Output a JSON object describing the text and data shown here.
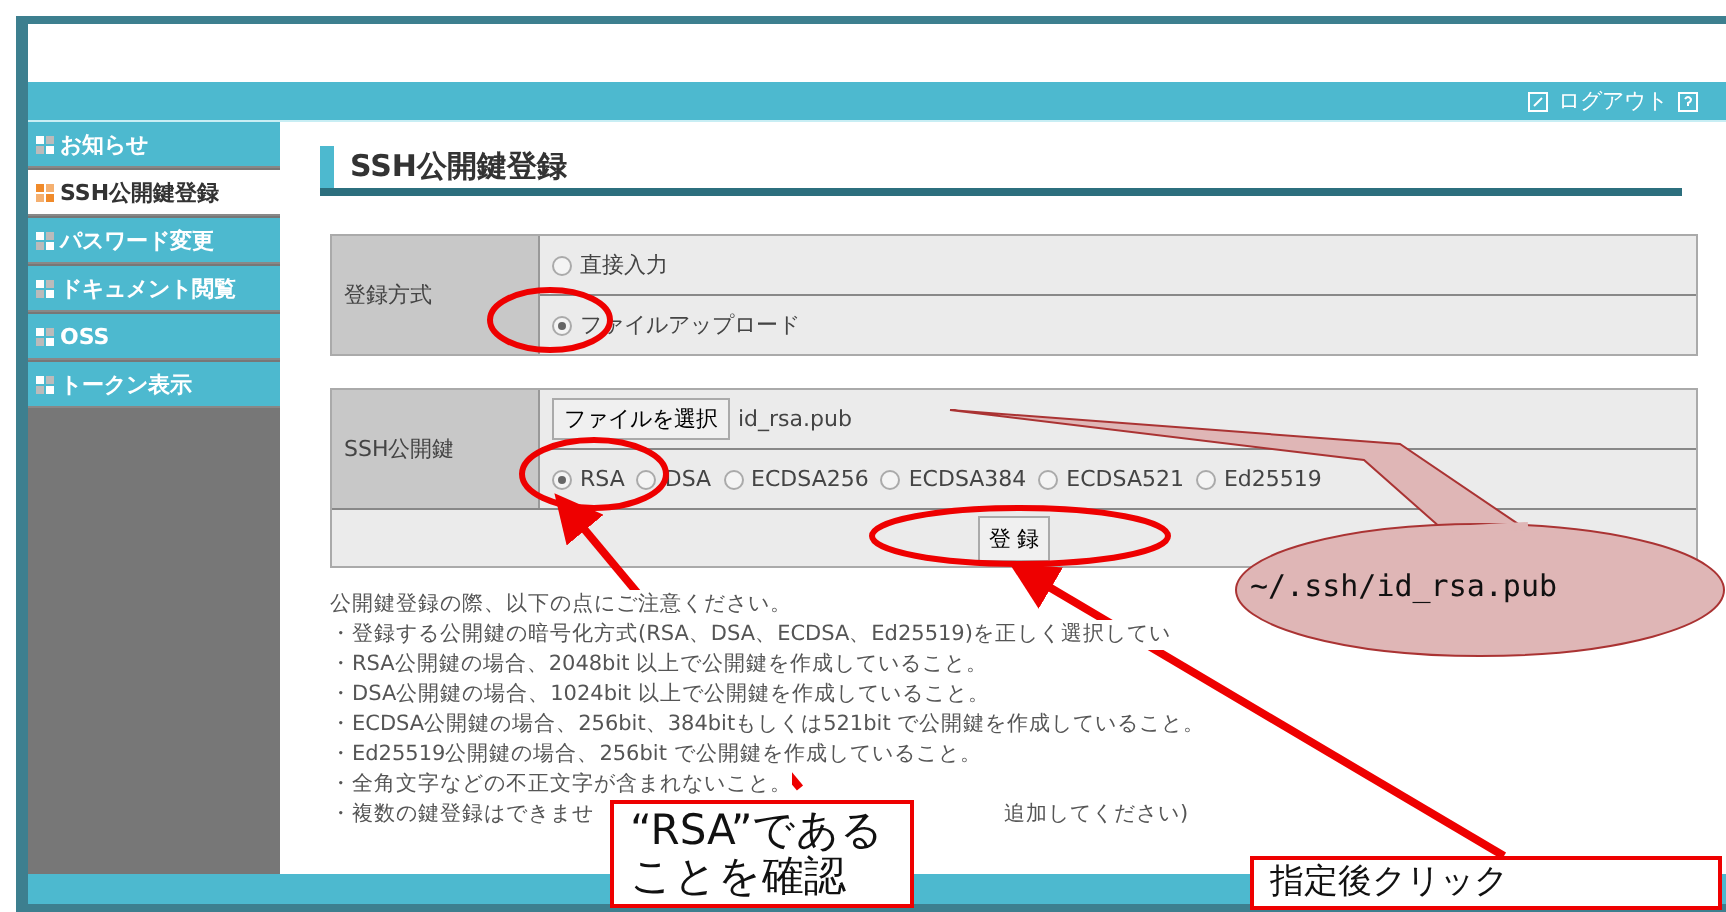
{
  "header": {
    "logout": "ログアウト"
  },
  "sidebar": {
    "items": [
      {
        "label": "お知らせ",
        "selected": false
      },
      {
        "label": "SSH公開鍵登録",
        "selected": true
      },
      {
        "label": "パスワード変更",
        "selected": false
      },
      {
        "label": "ドキュメント閲覧",
        "selected": false
      },
      {
        "label": "OSS",
        "selected": false
      },
      {
        "label": "トークン表示",
        "selected": false
      }
    ]
  },
  "page_title": "SSH公開鍵登録",
  "method": {
    "label": "登録方式",
    "options": [
      {
        "label": "直接入力",
        "selected": false
      },
      {
        "label": "ファイルアップロード",
        "selected": true
      }
    ]
  },
  "key": {
    "label": "SSH公開鍵",
    "file_button": "ファイルを選択",
    "file_name": "id_rsa.pub",
    "types": [
      {
        "label": "RSA",
        "selected": true
      },
      {
        "label": "DSA",
        "selected": false
      },
      {
        "label": "ECDSA256",
        "selected": false
      },
      {
        "label": "ECDSA384",
        "selected": false
      },
      {
        "label": "ECDSA521",
        "selected": false
      },
      {
        "label": "Ed25519",
        "selected": false
      }
    ],
    "submit": "登 録"
  },
  "notes": [
    {
      "text": "公開鍵登録の際、以下の点にご注意ください。"
    },
    {
      "text": "・登録する公開鍵の暗号化方式(RSA、DSA、ECDSA、Ed25519)を正しく選択してい"
    },
    {
      "text": "・RSA公開鍵の場合、2048bit 以上で公開鍵を作成していること。"
    },
    {
      "text": "・DSA公開鍵の場合、1024bit 以上で公開鍵を作成していること。"
    },
    {
      "text": "・ECDSA公開鍵の場合、256bit、384bitもしくは521bit で公開鍵を作成していること。"
    },
    {
      "text": "・Ed25519公開鍵の場合、256bit で公開鍵を作成していること。"
    },
    {
      "text": "・全角文字などの不正文字が含まれないこと。"
    },
    {
      "text": "・複数の鍵登録はできませ",
      "tail": "追加してください)"
    }
  ],
  "annotations": [
    {
      "kind": "callout",
      "text": "~/.ssh/id_rsa.pub"
    },
    {
      "kind": "box",
      "text": "“RSA”であることを確認"
    },
    {
      "kind": "box",
      "text": "指定後クリック"
    }
  ]
}
